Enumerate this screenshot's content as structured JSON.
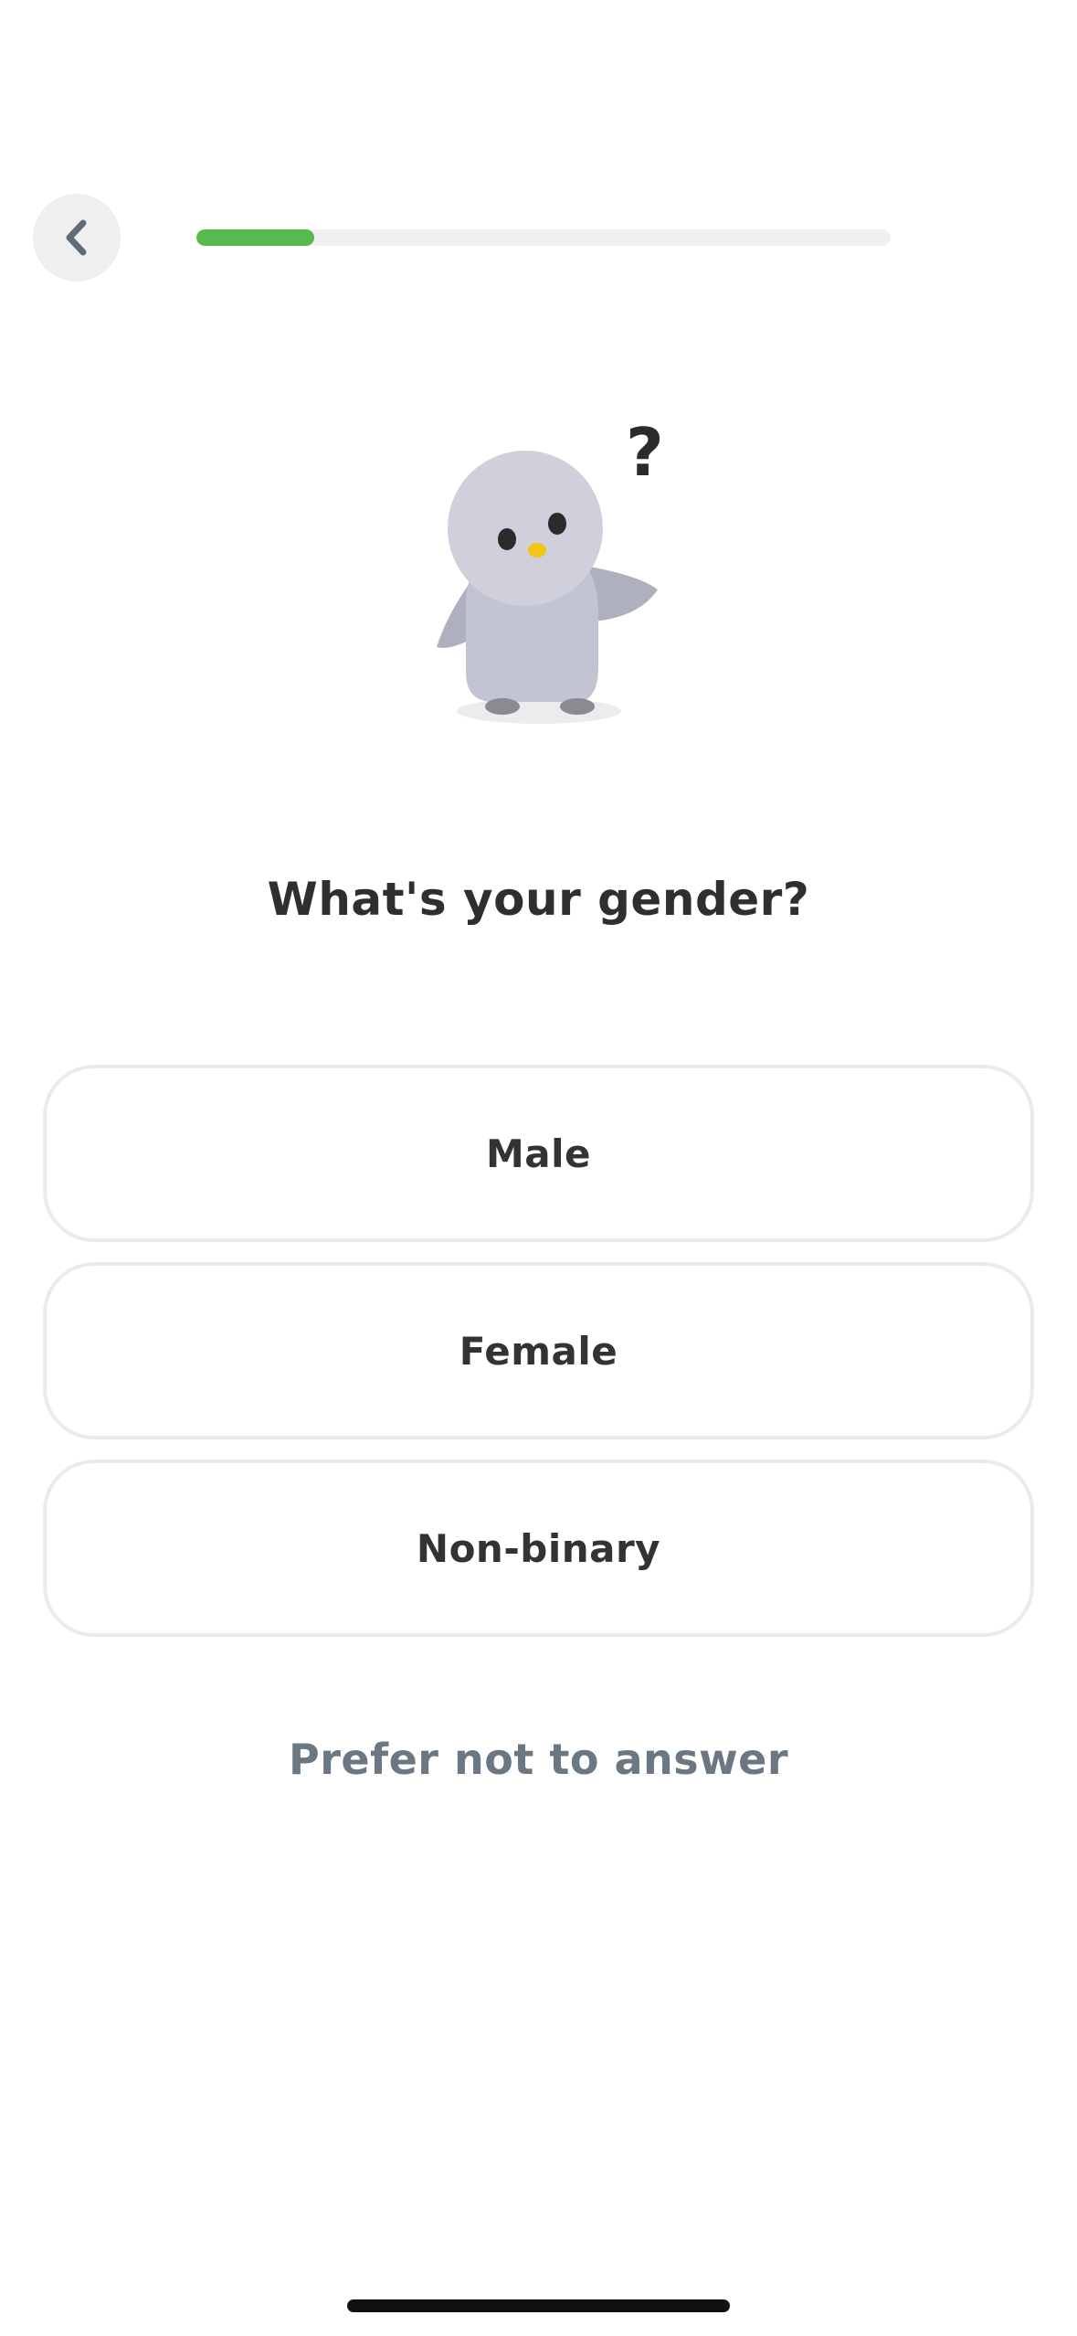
{
  "header": {
    "back_icon": "chevron-left-icon",
    "progress_fraction": 0.17,
    "progress_color": "#58b94f",
    "track_color": "#f0f0f0"
  },
  "mascot": {
    "icon": "confused-bird-mascot",
    "question_mark": "?"
  },
  "question": {
    "title": "What's your gender?"
  },
  "options": [
    {
      "label": "Male"
    },
    {
      "label": "Female"
    },
    {
      "label": "Non-binary"
    }
  ],
  "skip": {
    "label": "Prefer not to answer",
    "color": "#6b7883"
  }
}
